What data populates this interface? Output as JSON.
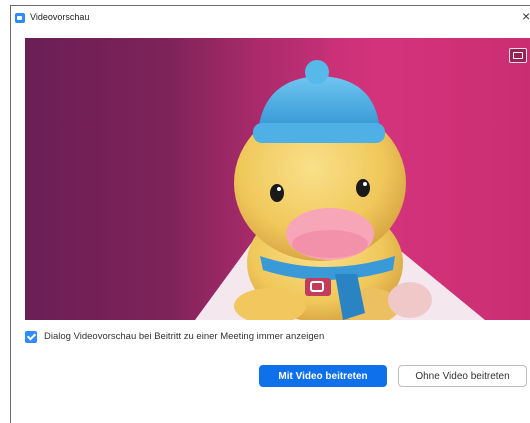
{
  "window": {
    "title": "Videovorschau",
    "close_glyph": "×",
    "app_icon": "zoom-camera-icon"
  },
  "preview": {
    "background_colors": [
      "#6a1f55",
      "#d6347e"
    ],
    "camera_control_icon": "switch-camera-icon"
  },
  "options": {
    "always_show_preview": {
      "label": "Dialog Videovorschau bei Beitritt zu einer Meeting immer anzeigen",
      "checked": true
    }
  },
  "buttons": {
    "join_with_video": "Mit Video beitreten",
    "join_without_video": "Ohne Video beitreten"
  },
  "colors": {
    "accent": "#0e71eb",
    "checkbox": "#2d8cff"
  }
}
